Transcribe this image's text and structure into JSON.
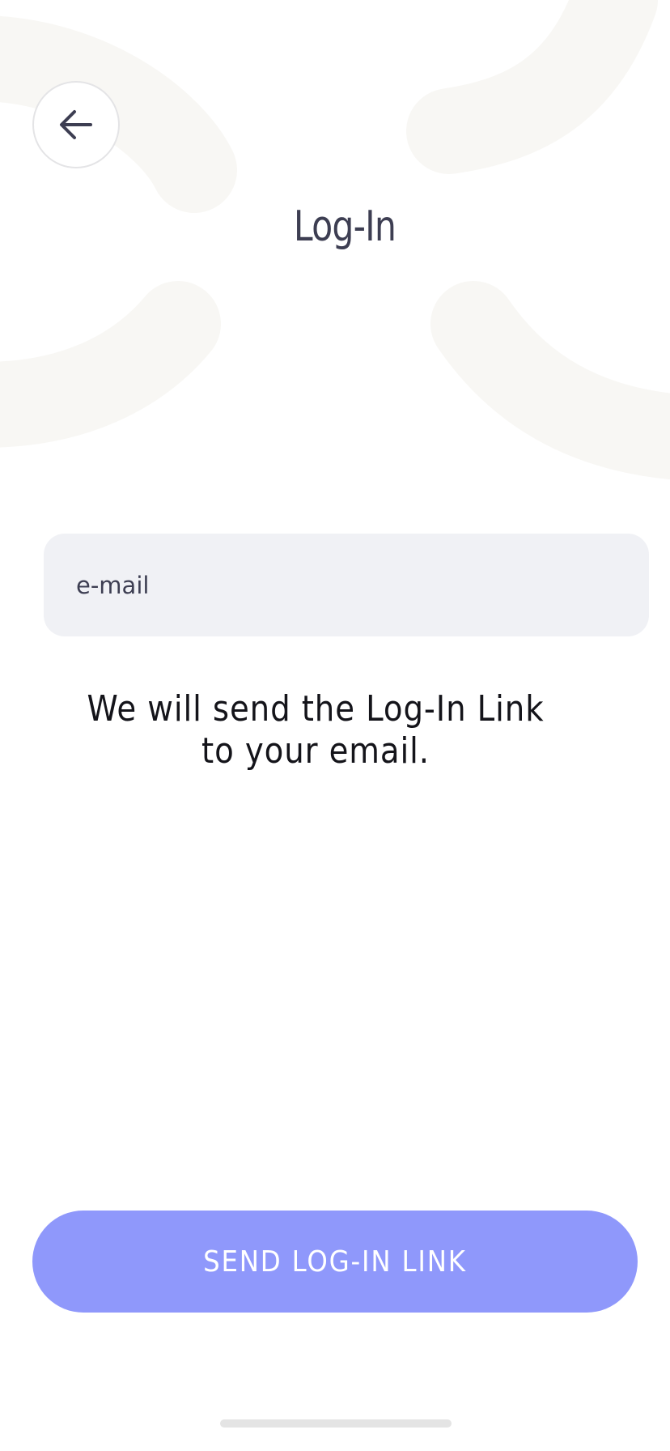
{
  "header": {
    "back_icon": "arrow-left-icon",
    "title": "Log-In"
  },
  "form": {
    "email_placeholder": "e-mail",
    "email_value": "",
    "helper_text": "We will send the Log-In Link to your email."
  },
  "actions": {
    "send_label": "SEND LOG-IN LINK"
  },
  "colors": {
    "accent": "#8f98fb",
    "title_text": "#3d3e52",
    "field_bg": "#f0f1f5",
    "decor": "#f8f7f4"
  }
}
